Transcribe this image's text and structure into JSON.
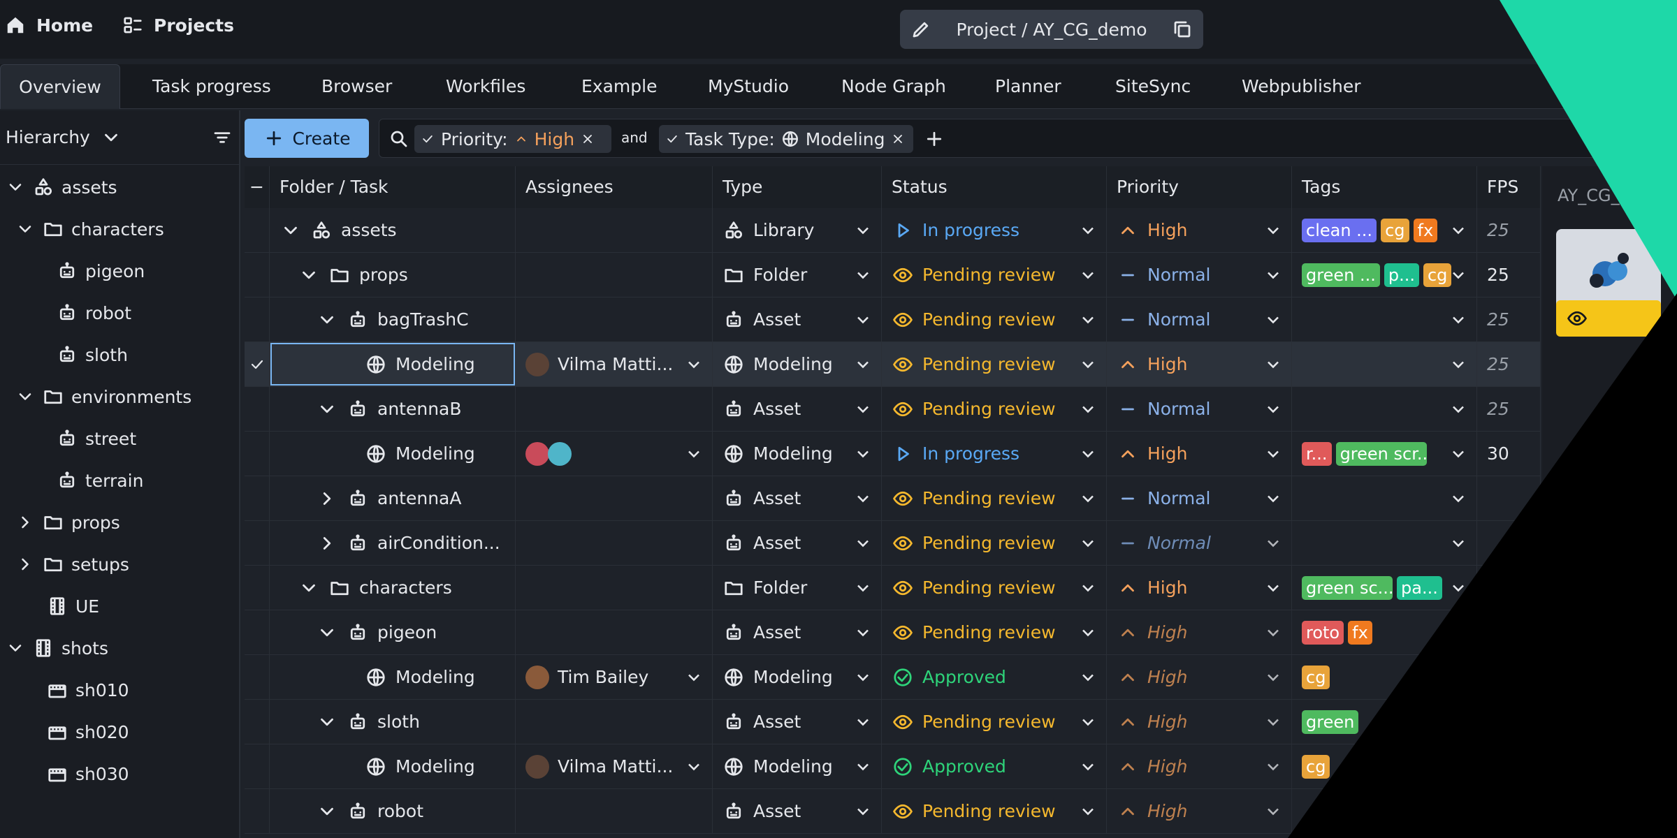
{
  "nav": {
    "home": "Home",
    "projects": "Projects",
    "project_path": "Project / AY_CG_demo"
  },
  "tabs": [
    "Overview",
    "Task progress",
    "Browser",
    "Workfiles",
    "Example",
    "MyStudio",
    "Node Graph",
    "Planner",
    "SiteSync",
    "Webpublisher"
  ],
  "sidebar": {
    "mode": "Hierarchy",
    "tree": [
      {
        "label": "assets",
        "icon": "library-icon",
        "chev": "down"
      },
      {
        "label": "characters",
        "icon": "folder-icon",
        "chev": "down"
      },
      {
        "label": "pigeon",
        "icon": "asset-icon",
        "chev": ""
      },
      {
        "label": "robot",
        "icon": "asset-icon",
        "chev": ""
      },
      {
        "label": "sloth",
        "icon": "asset-icon",
        "chev": ""
      },
      {
        "label": "environments",
        "icon": "folder-icon",
        "chev": "down"
      },
      {
        "label": "street",
        "icon": "asset-icon",
        "chev": ""
      },
      {
        "label": "terrain",
        "icon": "asset-icon",
        "chev": ""
      },
      {
        "label": "props",
        "icon": "folder-icon",
        "chev": "right"
      },
      {
        "label": "setups",
        "icon": "folder-icon",
        "chev": "right"
      },
      {
        "label": "UE",
        "icon": "film-icon",
        "chev": ""
      },
      {
        "label": "shots",
        "icon": "film-icon",
        "chev": "down"
      },
      {
        "label": "sh010",
        "icon": "shot-icon",
        "chev": ""
      },
      {
        "label": "sh020",
        "icon": "shot-icon",
        "chev": ""
      },
      {
        "label": "sh030",
        "icon": "shot-icon",
        "chev": ""
      }
    ]
  },
  "toolbar": {
    "create": "Create"
  },
  "filters": {
    "f1_key": "Priority:",
    "f1_val": "High",
    "joiner": "and",
    "f2_key": "Task Type:",
    "f2_val": "Modeling"
  },
  "columns": [
    "Folder / Task",
    "Assignees",
    "Type",
    "Status",
    "Priority",
    "Tags",
    "FPS"
  ],
  "rows": [
    {
      "name": "assets",
      "icon": "library-icon",
      "chev": "down",
      "assignees": "",
      "type": "Library",
      "typeicon": "library-icon",
      "status": "In progress",
      "priority": "High",
      "tags": [
        {
          "t": "clean ...",
          "c": "#6a6ff0"
        },
        {
          "t": "cg",
          "c": "#e8a33a"
        },
        {
          "t": "fx",
          "c": "#f07a1f"
        }
      ],
      "fps": "25"
    },
    {
      "name": "props",
      "icon": "folder-icon",
      "chev": "down",
      "assignees": "",
      "type": "Folder",
      "typeicon": "folder-icon",
      "status": "Pending review",
      "priority": "Normal",
      "tags": [
        {
          "t": "green ...",
          "c": "#4fba5f"
        },
        {
          "t": "p...",
          "c": "#1fbf8f"
        },
        {
          "t": "cg",
          "c": "#e8a33a"
        }
      ],
      "fps": "25"
    },
    {
      "name": "bagTrashC",
      "icon": "asset-icon",
      "chev": "down",
      "assignees": "",
      "type": "Asset",
      "typeicon": "asset-icon",
      "status": "Pending review",
      "priority": "Normal",
      "tags": [],
      "fps": "25"
    },
    {
      "name": "Modeling",
      "icon": "task-icon",
      "chev": "",
      "assignees": "Vilma Matti...",
      "type": "Modeling",
      "typeicon": "task-icon",
      "status": "Pending review",
      "priority": "High",
      "tags": [],
      "fps": "25"
    },
    {
      "name": "antennaB",
      "icon": "asset-icon",
      "chev": "down",
      "assignees": "",
      "type": "Asset",
      "typeicon": "asset-icon",
      "status": "Pending review",
      "priority": "Normal",
      "tags": [],
      "fps": "25"
    },
    {
      "name": "Modeling",
      "icon": "task-icon",
      "chev": "",
      "assignees": "",
      "type": "Modeling",
      "typeicon": "task-icon",
      "status": "In progress",
      "priority": "High",
      "tags": [
        {
          "t": "r...",
          "c": "#e05a5a"
        },
        {
          "t": "green scr...",
          "c": "#4fba5f"
        }
      ],
      "fps": "30"
    },
    {
      "name": "antennaA",
      "icon": "asset-icon",
      "chev": "right",
      "assignees": "",
      "type": "Asset",
      "typeicon": "asset-icon",
      "status": "Pending review",
      "priority": "Normal",
      "tags": [],
      "fps": ""
    },
    {
      "name": "airCondition...",
      "icon": "asset-icon",
      "chev": "right",
      "assignees": "",
      "type": "Asset",
      "typeicon": "asset-icon",
      "status": "Pending review",
      "priority": "Normal",
      "tags": [],
      "fps": ""
    },
    {
      "name": "characters",
      "icon": "folder-icon",
      "chev": "down",
      "assignees": "",
      "type": "Folder",
      "typeicon": "folder-icon",
      "status": "Pending review",
      "priority": "High",
      "tags": [
        {
          "t": "green sc...",
          "c": "#4fba5f"
        },
        {
          "t": "pa...",
          "c": "#1fbf8f"
        }
      ],
      "fps": ""
    },
    {
      "name": "pigeon",
      "icon": "asset-icon",
      "chev": "down",
      "assignees": "",
      "type": "Asset",
      "typeicon": "asset-icon",
      "status": "Pending review",
      "priority": "High",
      "tags": [
        {
          "t": "roto",
          "c": "#e05a5a"
        },
        {
          "t": "fx",
          "c": "#f07a1f"
        }
      ],
      "fps": ""
    },
    {
      "name": "Modeling",
      "icon": "task-icon",
      "chev": "",
      "assignees": "Tim Bailey",
      "type": "Modeling",
      "typeicon": "task-icon",
      "status": "Approved",
      "priority": "High",
      "tags": [
        {
          "t": "cg",
          "c": "#e8a33a"
        }
      ],
      "fps": ""
    },
    {
      "name": "sloth",
      "icon": "asset-icon",
      "chev": "down",
      "assignees": "",
      "type": "Asset",
      "typeicon": "asset-icon",
      "status": "Pending review",
      "priority": "High",
      "tags": [
        {
          "t": "green",
          "c": "#4fba5f"
        }
      ],
      "fps": ""
    },
    {
      "name": "Modeling",
      "icon": "task-icon",
      "chev": "",
      "assignees": "Vilma Matti...",
      "type": "Modeling",
      "typeicon": "task-icon",
      "status": "Approved",
      "priority": "High",
      "tags": [
        {
          "t": "cg",
          "c": "#e8a33a"
        }
      ],
      "fps": ""
    },
    {
      "name": "robot",
      "icon": "asset-icon",
      "chev": "down",
      "assignees": "",
      "type": "Asset",
      "typeicon": "asset-icon",
      "status": "Pending review",
      "priority": "High",
      "tags": [],
      "fps": ""
    }
  ],
  "right_panel": {
    "title": "AY_CG_"
  },
  "colors": {
    "accent_blue": "#7ab6f2",
    "pending": "#f5b82e",
    "in_progress": "#5aa9f5",
    "approved": "#2ed47a",
    "high": "#f5a15c",
    "normal": "#8bb1e8",
    "decor_green": "#1ed8a8"
  }
}
